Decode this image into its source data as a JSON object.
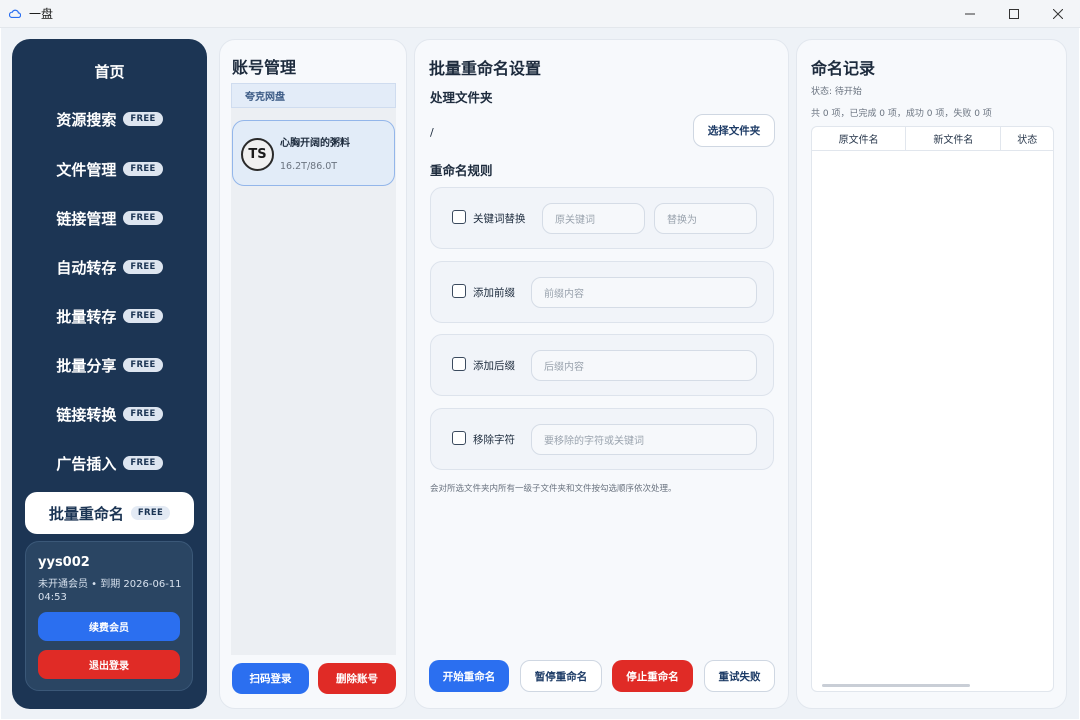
{
  "window": {
    "title": "一盘",
    "controls": [
      "minimize-icon",
      "maximize-icon",
      "close-icon"
    ]
  },
  "sidebar": {
    "items": [
      {
        "label": "首页",
        "badge": ""
      },
      {
        "label": "资源搜索",
        "badge": "FREE"
      },
      {
        "label": "文件管理",
        "badge": "FREE"
      },
      {
        "label": "链接管理",
        "badge": "FREE"
      },
      {
        "label": "自动转存",
        "badge": "FREE"
      },
      {
        "label": "批量转存",
        "badge": "FREE"
      },
      {
        "label": "批量分享",
        "badge": "FREE"
      },
      {
        "label": "链接转换",
        "badge": "FREE"
      },
      {
        "label": "广告插入",
        "badge": "FREE"
      },
      {
        "label": "批量重命名",
        "badge": "FREE"
      }
    ],
    "active_item": "批量重命名",
    "user": {
      "name": "yys002",
      "status": "未开通会员 • 到期 2026-06-11 04:53",
      "renew_label": "续费会员",
      "logout_label": "退出登录"
    }
  },
  "accounts": {
    "title": "账号管理",
    "tab": "夸克网盘",
    "list": [
      {
        "avatar_text": "TS",
        "name": "心胸开阔的粥料",
        "quota": "16.2T/86.0T"
      }
    ],
    "scan_login_label": "扫码登录",
    "delete_label": "删除账号"
  },
  "settings": {
    "title": "批量重命名设置",
    "folder_section": "处理文件夹",
    "folder_path": "/",
    "choose_folder_label": "选择文件夹",
    "rules_section": "重命名规则",
    "rules": {
      "keyword": {
        "label": "关键词替换",
        "checked": false,
        "original_placeholder": "原关键词",
        "replace_placeholder": "替换为"
      },
      "prefix": {
        "label": "添加前缀",
        "checked": false,
        "placeholder": "前缀内容"
      },
      "suffix": {
        "label": "添加后缀",
        "checked": false,
        "placeholder": "后缀内容"
      },
      "remove": {
        "label": "移除字符",
        "checked": false,
        "placeholder": "要移除的字符或关键词"
      }
    },
    "hint": "会对所选文件夹内所有一级子文件夹和文件按勾选顺序依次处理。",
    "buttons": {
      "start": "开始重命名",
      "pause": "暂停重命名",
      "stop": "停止重命名",
      "retry": "重试失败"
    }
  },
  "log": {
    "title": "命名记录",
    "status": "状态: 待开始",
    "summary": "共 0 项，已完成 0 项，成功 0 项，失败 0 项",
    "columns": [
      "原文件名",
      "新文件名",
      "状态"
    ],
    "rows": []
  },
  "colors": {
    "sidebar_bg": "#1c3554",
    "primary": "#2b6ff0",
    "danger": "#e02b26",
    "panel_bg": "#f7f9fc"
  }
}
